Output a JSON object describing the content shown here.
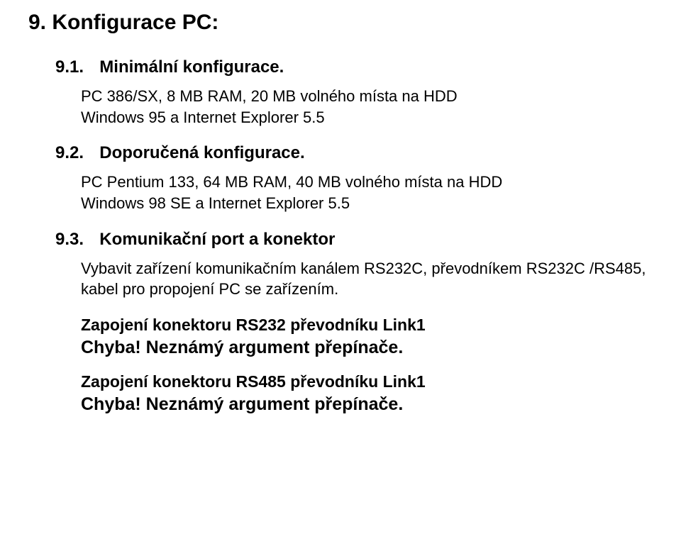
{
  "title": "9.  Konfigurace PC:",
  "sections": [
    {
      "number": "9.1.",
      "heading": "Minimální konfigurace.",
      "body1": "PC 386/SX, 8 MB RAM, 20 MB volného místa na HDD",
      "body2": "Windows 95 a Internet Explorer 5.5"
    },
    {
      "number": "9.2.",
      "heading": "Doporučená konfigurace.",
      "body1": "PC Pentium 133, 64 MB RAM, 40 MB volného místa na HDD",
      "body2": "Windows 98 SE a Internet Explorer 5.5"
    },
    {
      "number": "9.3.",
      "heading": "Komunikační port a konektor",
      "body1": "Vybavit zařízení komunikačním kanálem RS232C, převodníkem RS232C /RS485, kabel pro propojení PC se zařízením."
    }
  ],
  "wiring": [
    {
      "title": "Zapojení konektoru RS232 převodníku Link1",
      "error": "Chyba! Neznámý argument přepínače."
    },
    {
      "title": "Zapojení konektoru RS485 převodníku Link1",
      "error": "Chyba! Neznámý argument přepínače."
    }
  ]
}
